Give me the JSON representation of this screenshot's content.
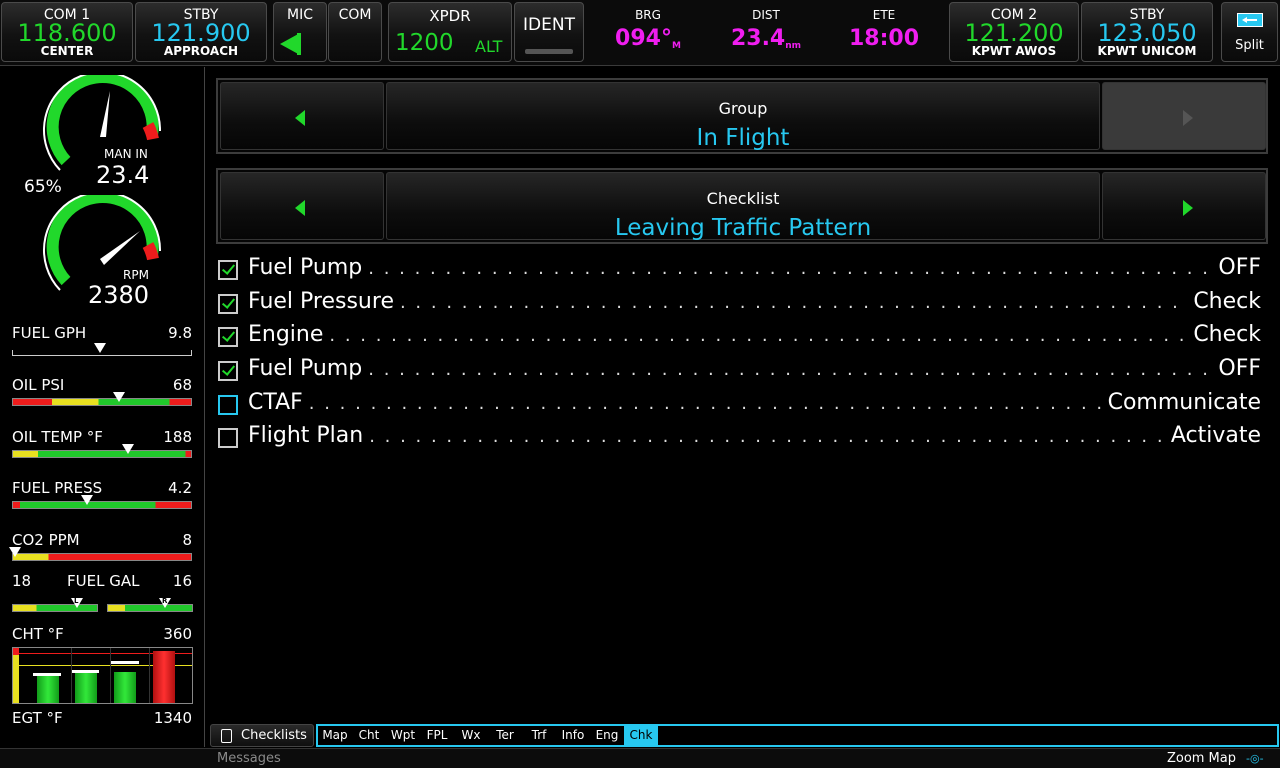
{
  "top_bar": {
    "com1": {
      "label": "COM 1",
      "freq": "118.600",
      "station": "CENTER"
    },
    "com1_stby": {
      "label": "STBY",
      "freq": "121.900",
      "station": "APPROACH"
    },
    "mic_label": "MIC",
    "com_label": "COM",
    "xpdr": {
      "label": "XPDR",
      "code": "1200",
      "mode": "ALT"
    },
    "ident_label": "IDENT",
    "nav": {
      "brg_label": "BRG",
      "brg_value": "094°",
      "brg_unit": "M",
      "dist_label": "DIST",
      "dist_value": "23.4",
      "dist_unit": "nm",
      "ete_label": "ETE",
      "ete_value": "18:00"
    },
    "com2": {
      "label": "COM 2",
      "freq": "121.200",
      "station": "KPWT AWOS"
    },
    "com2_stby": {
      "label": "STBY",
      "freq": "123.050",
      "station": "KPWT UNICOM"
    },
    "split_label": "Split"
  },
  "engine": {
    "map_pct": "65%",
    "man_in_label": "MAN IN",
    "man_in_value": "23.4",
    "rpm_label": "RPM",
    "rpm_value": "2380",
    "fuel_gph_label": "FUEL GPH",
    "fuel_gph_value": "9.8",
    "oil_psi_label": "OIL PSI",
    "oil_psi_value": "68",
    "oil_temp_label": "OIL TEMP °F",
    "oil_temp_value": "188",
    "fuel_press_label": "FUEL PRESS",
    "fuel_press_value": "4.2",
    "co2_label": "CO2 PPM",
    "co2_value": "8",
    "fuel_gal_label": "FUEL GAL",
    "fuel_gal_left": "18",
    "fuel_gal_right": "16",
    "cht_label": "CHT °F",
    "cht_value": "360",
    "egt_label": "EGT °F",
    "egt_value": "1340",
    "fuel_gal_left_tag": "L",
    "fuel_gal_right_tag": "R"
  },
  "selectors": {
    "group_label": "Group",
    "group_value": "In Flight",
    "checklist_label": "Checklist",
    "checklist_value": "Leaving Traffic Pattern"
  },
  "checklist_items": [
    {
      "item": "Fuel Pump",
      "action": "OFF",
      "checked": true
    },
    {
      "item": "Fuel Pressure",
      "action": "Check",
      "checked": true
    },
    {
      "item": "Engine",
      "action": "Check",
      "checked": true
    },
    {
      "item": "Fuel Pump",
      "action": "OFF",
      "checked": true
    },
    {
      "item": "CTAF",
      "action": "Communicate",
      "checked": false,
      "active": true
    },
    {
      "item": "Flight Plan",
      "action": "Activate",
      "checked": false
    }
  ],
  "bottom": {
    "checklists_button": "Checklists",
    "tabs": [
      "Map",
      "Cht",
      "Wpt",
      "FPL",
      "Wx",
      "Ter",
      "Trf",
      "Info",
      "Eng",
      "Chk"
    ],
    "active_tab": "Chk",
    "messages": "Messages",
    "zoom_map": "Zoom Map"
  },
  "colors": {
    "green": "#21d82b",
    "cyan": "#27c8f0",
    "magenta": "#f01ef0"
  }
}
